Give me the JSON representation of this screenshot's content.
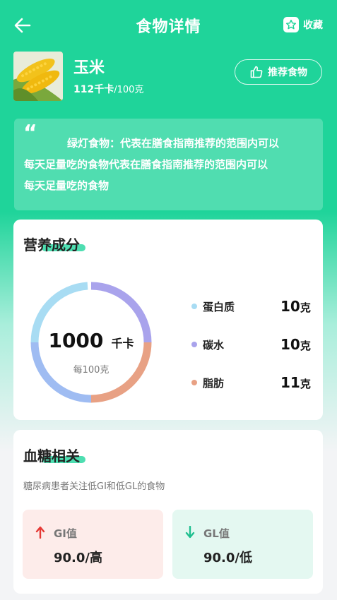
{
  "header": {
    "title": "食物详情",
    "favorite_label": "收藏",
    "back_icon": "arrow-left-icon",
    "favorite_icon": "star-icon"
  },
  "food": {
    "name": "玉米",
    "calories": "112千卡",
    "per": "/100克",
    "recommend_label": "推荐食物",
    "recommend_icon": "thumbs-up-icon"
  },
  "notice": {
    "line1": "绿灯食物：代表在膳食指南推荐的范围内可以",
    "line2": "每天足量吃的食物代表在膳食指南推荐的范围内可以",
    "line3": "每天足量吃的食物"
  },
  "nutrition": {
    "title": "营养成分",
    "total_value": "1000",
    "total_unit": "千卡",
    "per": "每100克",
    "items": [
      {
        "label": "蛋白质",
        "value": "10",
        "unit": "克",
        "color": "#a8dcf3"
      },
      {
        "label": "碳水",
        "value": "10",
        "unit": "克",
        "color": "#a9a3ec"
      },
      {
        "label": "脂肪",
        "value": "11",
        "unit": "克",
        "color": "#e8a184"
      }
    ],
    "ring_colors": {
      "protein_top": "#a8dcf3",
      "carbs": "#a9a3ec",
      "fat": "#e8a184",
      "left": "#9fbcf2"
    }
  },
  "blood_sugar": {
    "title": "血糖相关",
    "subtitle": "糖尿病患者关注低GI和低GL的食物",
    "gi": {
      "label": "GI值",
      "value": "90.0/高",
      "color": "#e53935",
      "bg": "#fdecea"
    },
    "gl": {
      "label": "GL值",
      "value": "90.0/低",
      "color": "#1fbf8f",
      "bg": "#e4f8f1"
    }
  }
}
